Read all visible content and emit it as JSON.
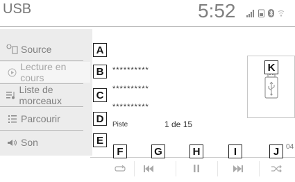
{
  "header": {
    "title": "USB",
    "clock": "5:52",
    "status_icons": [
      "signal-icon",
      "phone-battery-icon",
      "bluetooth-icon",
      "wifi-icon"
    ]
  },
  "sidebar": {
    "items": [
      {
        "label": "Source",
        "icon": "source-icon"
      },
      {
        "label": "Lecture en cours",
        "icon": "play-circle-icon"
      },
      {
        "label": "Liste de morceaux",
        "icon": "playlist-icon"
      },
      {
        "label": "Parcourir",
        "icon": "browse-icon"
      },
      {
        "label": "Son",
        "icon": "speaker-icon"
      }
    ]
  },
  "now_playing": {
    "line1": "**********",
    "line2": "**********",
    "line3": "**********",
    "piste_label": "Piste",
    "track_info": "1 de 15",
    "elapsed_suffix": "04"
  },
  "controls": [
    {
      "name": "repeat-icon"
    },
    {
      "name": "previous-track-icon"
    },
    {
      "name": "pause-icon"
    },
    {
      "name": "next-track-icon"
    },
    {
      "name": "shuffle-icon"
    }
  ],
  "callouts": {
    "A": "A",
    "B": "B",
    "C": "C",
    "D": "D",
    "E": "E",
    "F": "F",
    "G": "G",
    "H": "H",
    "I": "I",
    "J": "J",
    "K": "K"
  },
  "colors": {
    "text_gray": "#808080",
    "callout_border": "#222222",
    "panel_bg": "#ececec"
  }
}
